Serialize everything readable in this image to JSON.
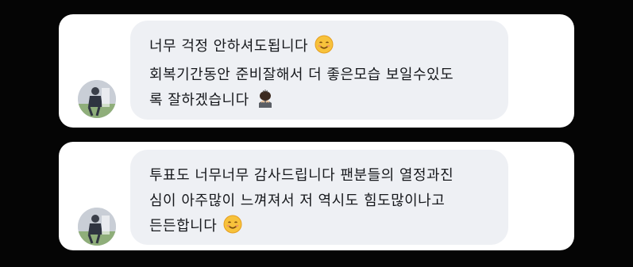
{
  "messages": [
    {
      "lines": [
        "너무 걱정 안하셔도됩니다",
        "회복기간동안 준비잘해서 더 좋은모습 보일수있도",
        "록 잘하겠습니다"
      ],
      "emojis": [
        "smiling-face-emoji",
        "bowing-person-emoji"
      ]
    },
    {
      "lines": [
        "투표도 너무너무 감사드립니다 팬분들의 열정과진",
        "심이 아주많이 느껴져서 저 역시도 힘도많이나고",
        "든든합니다"
      ],
      "emojis": [
        "smiling-face-emoji"
      ]
    }
  ],
  "colors": {
    "background": "#050505",
    "card": "#ffffff",
    "bubble": "#eef0f4",
    "text": "#16181c"
  }
}
